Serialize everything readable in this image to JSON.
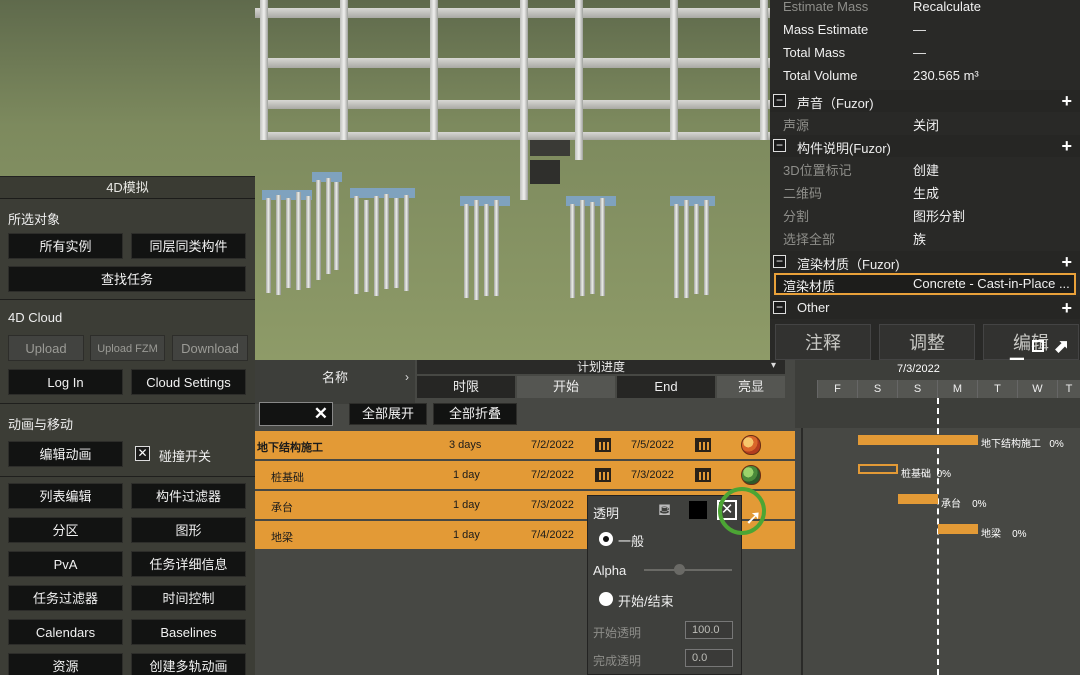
{
  "panel4d": {
    "title": "4D模拟",
    "selected_objects_label": "所选对象",
    "all_instances": "所有实例",
    "same_layer": "同层同类构件",
    "find_task": "查找任务",
    "cloud_label": "4D Cloud",
    "upload": "Upload",
    "upload_fzm": "Upload FZM",
    "download": "Download",
    "log_in": "Log In",
    "cloud_settings": "Cloud Settings",
    "anim_label": "动画与移动",
    "edit_anim": "编辑动画",
    "collision_toggle": "碰撞开关",
    "collision_checked": true,
    "buttons": [
      "列表编辑",
      "构件过滤器",
      "分区",
      "图形",
      "PvA",
      "任务详细信息",
      "任务过滤器",
      "时间控制",
      "Calendars",
      "Baselines",
      "资源",
      "创建多轨动画"
    ]
  },
  "props": {
    "rows_top": [
      {
        "key": "Estimate Mass",
        "value": "Recalculate",
        "dim": true
      },
      {
        "key": "Mass Estimate",
        "value": "—",
        "dim": false
      },
      {
        "key": "Total Mass",
        "value": "—",
        "dim": false
      },
      {
        "key": "Total Volume",
        "value": "230.565 m³",
        "dim": false
      }
    ],
    "cat_sound": "声音（Fuzor)",
    "sound_source": {
      "key": "声源",
      "value": "关闭"
    },
    "cat_desc": "构件说明(Fuzor)",
    "desc_rows": [
      {
        "key": "3D位置标记",
        "value": "创建"
      },
      {
        "key": "二维码",
        "value": "生成"
      },
      {
        "key": "分割",
        "value": "图形分割"
      },
      {
        "key": "选择全部",
        "value": "族"
      }
    ],
    "cat_render": "渲染材质（Fuzor)",
    "render_row": {
      "key": "渲染材质",
      "value": "Concrete - Cast-in-Place ..."
    },
    "cat_other": "Other",
    "bottom_buttons": [
      "注释",
      "调整",
      "编辑"
    ]
  },
  "grid": {
    "name_header": "名称",
    "plan_header": "计划进度",
    "duration_header": "时限",
    "start_header": "开始",
    "end_header": "End",
    "highlight_header": "亮显",
    "expand_all": "全部展开",
    "collapse_all": "全部折叠",
    "search_value": "",
    "tasks": [
      {
        "name": "地下结构施工",
        "duration": "3 days",
        "start": "7/2/2022",
        "end": "7/5/2022"
      },
      {
        "name": "桩基础",
        "duration": "1 day",
        "start": "7/2/2022",
        "end": "7/3/2022"
      },
      {
        "name": "承台",
        "duration": "1 day",
        "start": "7/3/2022",
        "end": ""
      },
      {
        "name": "地梁",
        "duration": "1 day",
        "start": "7/4/2022",
        "end": ""
      }
    ]
  },
  "popup": {
    "title": "透明",
    "normal": "一般",
    "alpha": "Alpha",
    "start_end": "开始/结束",
    "start_transparency": "开始透明",
    "start_value": "100.0",
    "finish_transparency": "完成透明",
    "finish_value": "0.0"
  },
  "gantt": {
    "date": "7/3/2022",
    "days": [
      "F",
      "S",
      "S",
      "M",
      "T",
      "W",
      "T"
    ],
    "bars": [
      {
        "label": "地下结构施工",
        "pct": "0%"
      },
      {
        "label": "桩基础",
        "pct": "0%"
      },
      {
        "label": "承台",
        "pct": "0%"
      },
      {
        "label": "地梁",
        "pct": "0%"
      }
    ]
  },
  "colors": {
    "accent": "#e39a36",
    "panel": "#3c3d36",
    "button": "#121312"
  },
  "icons": [
    "close-icon",
    "calendar-icon",
    "palette-icon",
    "paint-bucket-icon",
    "minimize-icon",
    "restore-icon",
    "expand-arrow-icon",
    "chevron-right-icon",
    "chevron-down-icon"
  ]
}
